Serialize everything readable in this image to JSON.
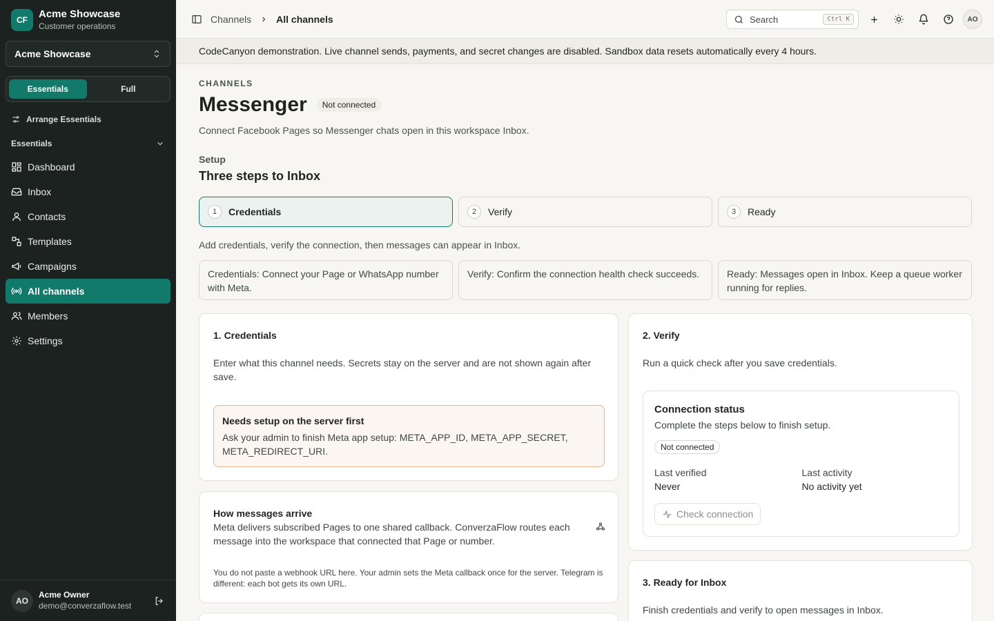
{
  "brand": {
    "logo": "CF",
    "name": "Acme Showcase",
    "subtitle": "Customer operations"
  },
  "workspace_select": {
    "value": "Acme Showcase"
  },
  "mode": {
    "essentials": "Essentials",
    "full": "Full",
    "active": "Essentials"
  },
  "arrange_label": "Arrange Essentials",
  "nav_group": "Essentials",
  "nav": [
    {
      "label": "Dashboard",
      "icon": "dashboard-icon"
    },
    {
      "label": "Inbox",
      "icon": "inbox-icon"
    },
    {
      "label": "Contacts",
      "icon": "contacts-icon"
    },
    {
      "label": "Templates",
      "icon": "templates-icon"
    },
    {
      "label": "Campaigns",
      "icon": "megaphone-icon"
    },
    {
      "label": "All channels",
      "icon": "broadcast-icon",
      "active": true
    },
    {
      "label": "Members",
      "icon": "members-icon"
    },
    {
      "label": "Settings",
      "icon": "gear-icon"
    }
  ],
  "user": {
    "initials": "AO",
    "name": "Acme Owner",
    "email": "demo@converzaflow.test"
  },
  "breadcrumb": {
    "parent": "Channels",
    "current": "All channels"
  },
  "search": {
    "placeholder": "Search",
    "shortcut": "Ctrl K"
  },
  "top_avatar": "AO",
  "banner": "CodeCanyon demonstration. Live channel sends, payments, and secret changes are disabled. Sandbox data resets automatically every 4 hours.",
  "page": {
    "eyebrow": "CHANNELS",
    "title": "Messenger",
    "status": "Not connected",
    "subtitle": "Connect Facebook Pages so Messenger chats open in this workspace Inbox."
  },
  "setup": {
    "eyebrow": "Setup",
    "title": "Three steps to Inbox",
    "steps": [
      {
        "num": "1",
        "label": "Credentials"
      },
      {
        "num": "2",
        "label": "Verify"
      },
      {
        "num": "3",
        "label": "Ready"
      }
    ],
    "hint": "Add credentials, verify the connection, then messages can appear in Inbox.",
    "notes": [
      "Credentials: Connect your Page or WhatsApp number with Meta.",
      "Verify: Confirm the connection health check succeeds.",
      "Ready: Messages open in Inbox. Keep a queue worker running for replies."
    ]
  },
  "credentials_card": {
    "title": "1. Credentials",
    "text": "Enter what this channel needs. Secrets stay on the server and are not shown again after save.",
    "warning_title": "Needs setup on the server first",
    "warning_text": "Ask your admin to finish Meta app setup: META_APP_ID, META_APP_SECRET, META_REDIRECT_URI."
  },
  "arrive_card": {
    "title": "How messages arrive",
    "text": "Meta delivers subscribed Pages to one shared callback. ConverzaFlow routes each message into the workspace that connected that Page or number.",
    "footnote": "You do not paste a webhook URL here. Your admin sets the Meta callback once for the server. Telegram is different: each bot gets its own URL."
  },
  "verify_card": {
    "title": "2. Verify",
    "text": "Run a quick check after you save credentials.",
    "status_title": "Connection status",
    "status_text": "Complete the steps below to finish setup.",
    "status_badge": "Not connected",
    "last_verified_label": "Last verified",
    "last_verified_value": "Never",
    "last_activity_label": "Last activity",
    "last_activity_value": "No activity yet",
    "check_button": "Check connection"
  },
  "ready_card": {
    "title": "3. Ready for Inbox",
    "text": "Finish credentials and verify to open messages in Inbox."
  },
  "colors": {
    "accent": "#127a6a",
    "sidebar": "#1b2220",
    "warning_border": "#e4b58e"
  }
}
